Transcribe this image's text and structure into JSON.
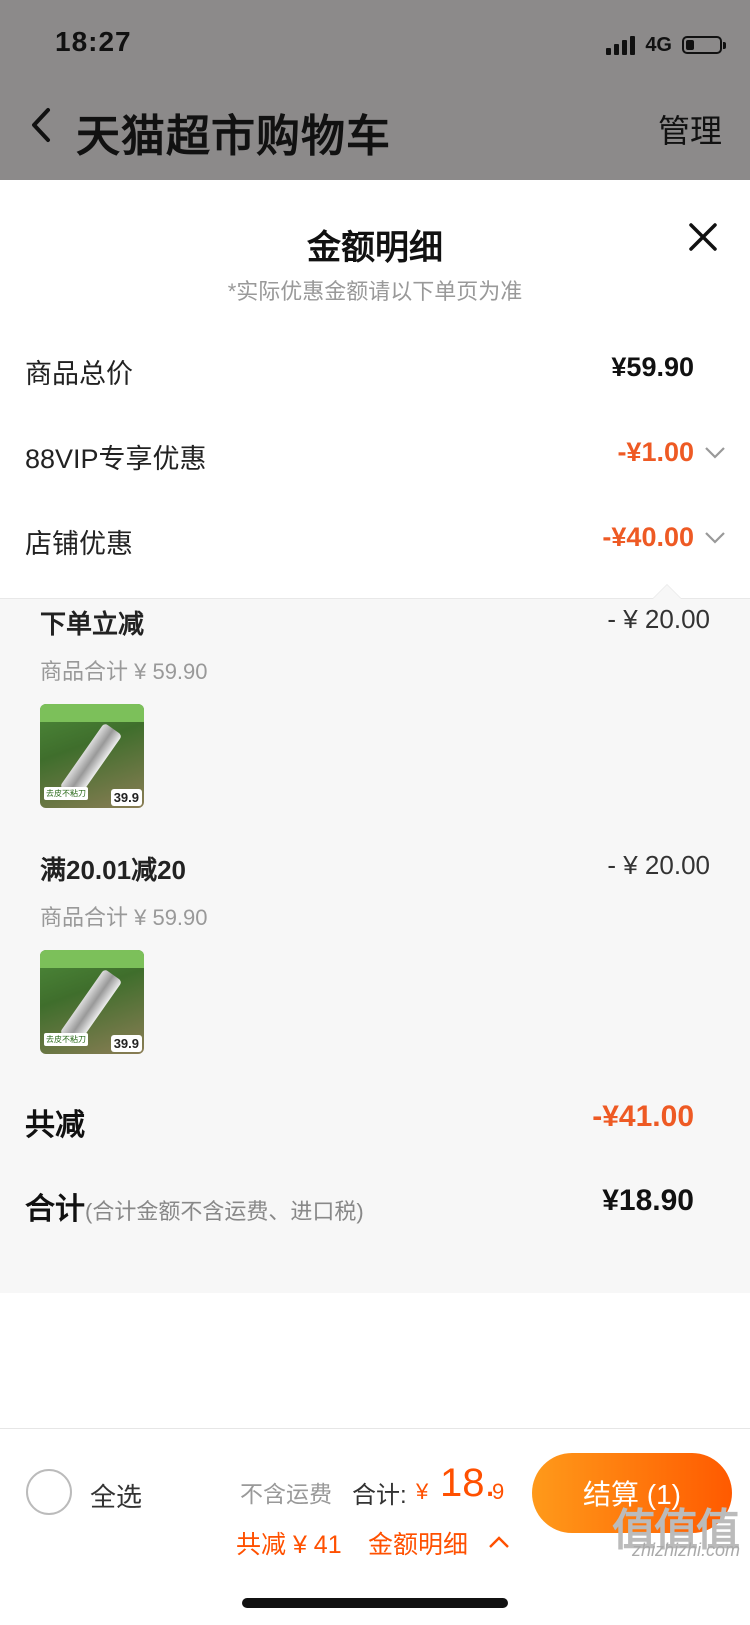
{
  "status_bar": {
    "time": "18:27",
    "network": "4G",
    "battery_level": 0.25
  },
  "header": {
    "title": "天猫超市购物车",
    "manage_label": "管理"
  },
  "sheet": {
    "title": "金额明细",
    "subtitle": "*实际优惠金额请以下单页为准",
    "rows": [
      {
        "label": "商品总价",
        "value": "¥59.90"
      },
      {
        "label": "88VIP专享优惠",
        "value": "-¥1.00"
      },
      {
        "label": "店铺优惠",
        "value": "-¥40.00"
      }
    ],
    "details": [
      {
        "title": "下单立减",
        "amount": "- ¥ 20.00",
        "subtotal": "商品合计 ¥ 59.90",
        "thumb_price": "39.9",
        "thumb_tag": "去皮不粘刀"
      },
      {
        "title": "满20.01减20",
        "amount": "- ¥ 20.00",
        "subtotal": "商品合计 ¥ 59.90",
        "thumb_price": "39.9",
        "thumb_tag": "去皮不粘刀"
      }
    ],
    "total_discount": {
      "label": "共减",
      "value": "-¥41.00"
    },
    "grand_total": {
      "label": "合计",
      "note": "(合计金额不含运费、进口税)",
      "value": "¥18.90"
    }
  },
  "bottom_bar": {
    "select_all": "全选",
    "shipping_note": "不含运费",
    "sum_label": "合计:",
    "sum_currency": "¥",
    "sum_integer": "18.",
    "sum_decimal": "9",
    "savings": "共减 ¥ 41",
    "detail_link": "金额明细",
    "checkout": "结算 (1)"
  },
  "watermark": {
    "logo": "值值值",
    "text": "zhizhizhi.com"
  },
  "colors": {
    "accent": "#ee5a24",
    "checkout_start": "#ff9a1a",
    "checkout_end": "#ff5a00"
  }
}
